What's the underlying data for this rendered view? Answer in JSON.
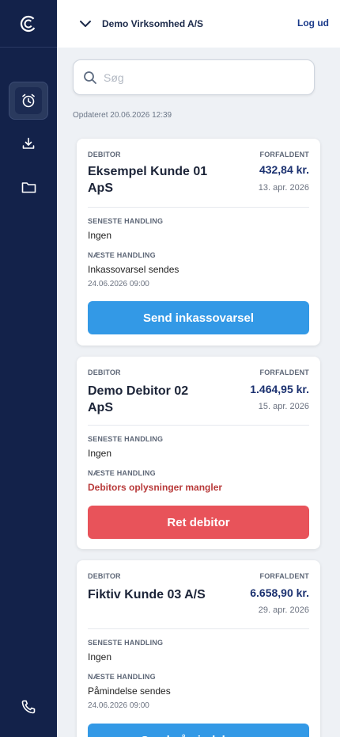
{
  "header": {
    "company": "Demo Virksomhed A/S",
    "logout_label": "Log ud"
  },
  "search": {
    "placeholder": "Søg",
    "value": ""
  },
  "updated_text": "Opdateret 20.06.2026 12:39",
  "labels": {
    "debitor": "DEBITOR",
    "forfaldent": "FORFALDENT",
    "seneste": "SENESTE HANDLING",
    "naeste": "NÆSTE HANDLING"
  },
  "cards": [
    {
      "name": "Eksempel Kunde 01 ApS",
      "amount": "432,84 kr.",
      "due_date": "13. apr. 2026",
      "last_action": "Ingen",
      "next_action": "Inkassovarsel sendes",
      "next_date": "24.06.2026 09:00",
      "button": "Send inkassovarsel"
    },
    {
      "name": "Demo Debitor 02 ApS",
      "amount": "1.464,95 kr.",
      "due_date": "15. apr. 2026",
      "last_action": "Ingen",
      "next_action": "Debitors oplysninger mangler",
      "button": "Ret debitor"
    },
    {
      "name": "Fiktiv Kunde 03 A/S",
      "amount": "6.658,90 kr.",
      "due_date": "29. apr. 2026",
      "last_action": "Ingen",
      "next_action": "Påmindelse sendes",
      "next_date": "24.06.2026 09:00",
      "button": "Send påmindelse nu"
    }
  ],
  "icons": {
    "logo": "logo-icon",
    "nav": [
      "alarm-clock-icon",
      "download-icon",
      "folder-icon"
    ],
    "support": "phone-icon"
  },
  "colors": {
    "sidebar": "#13224a",
    "primary_button": "#3399e6",
    "danger_button": "#e8535a",
    "amount": "#1b3170",
    "warning_text": "#b83a3a"
  }
}
